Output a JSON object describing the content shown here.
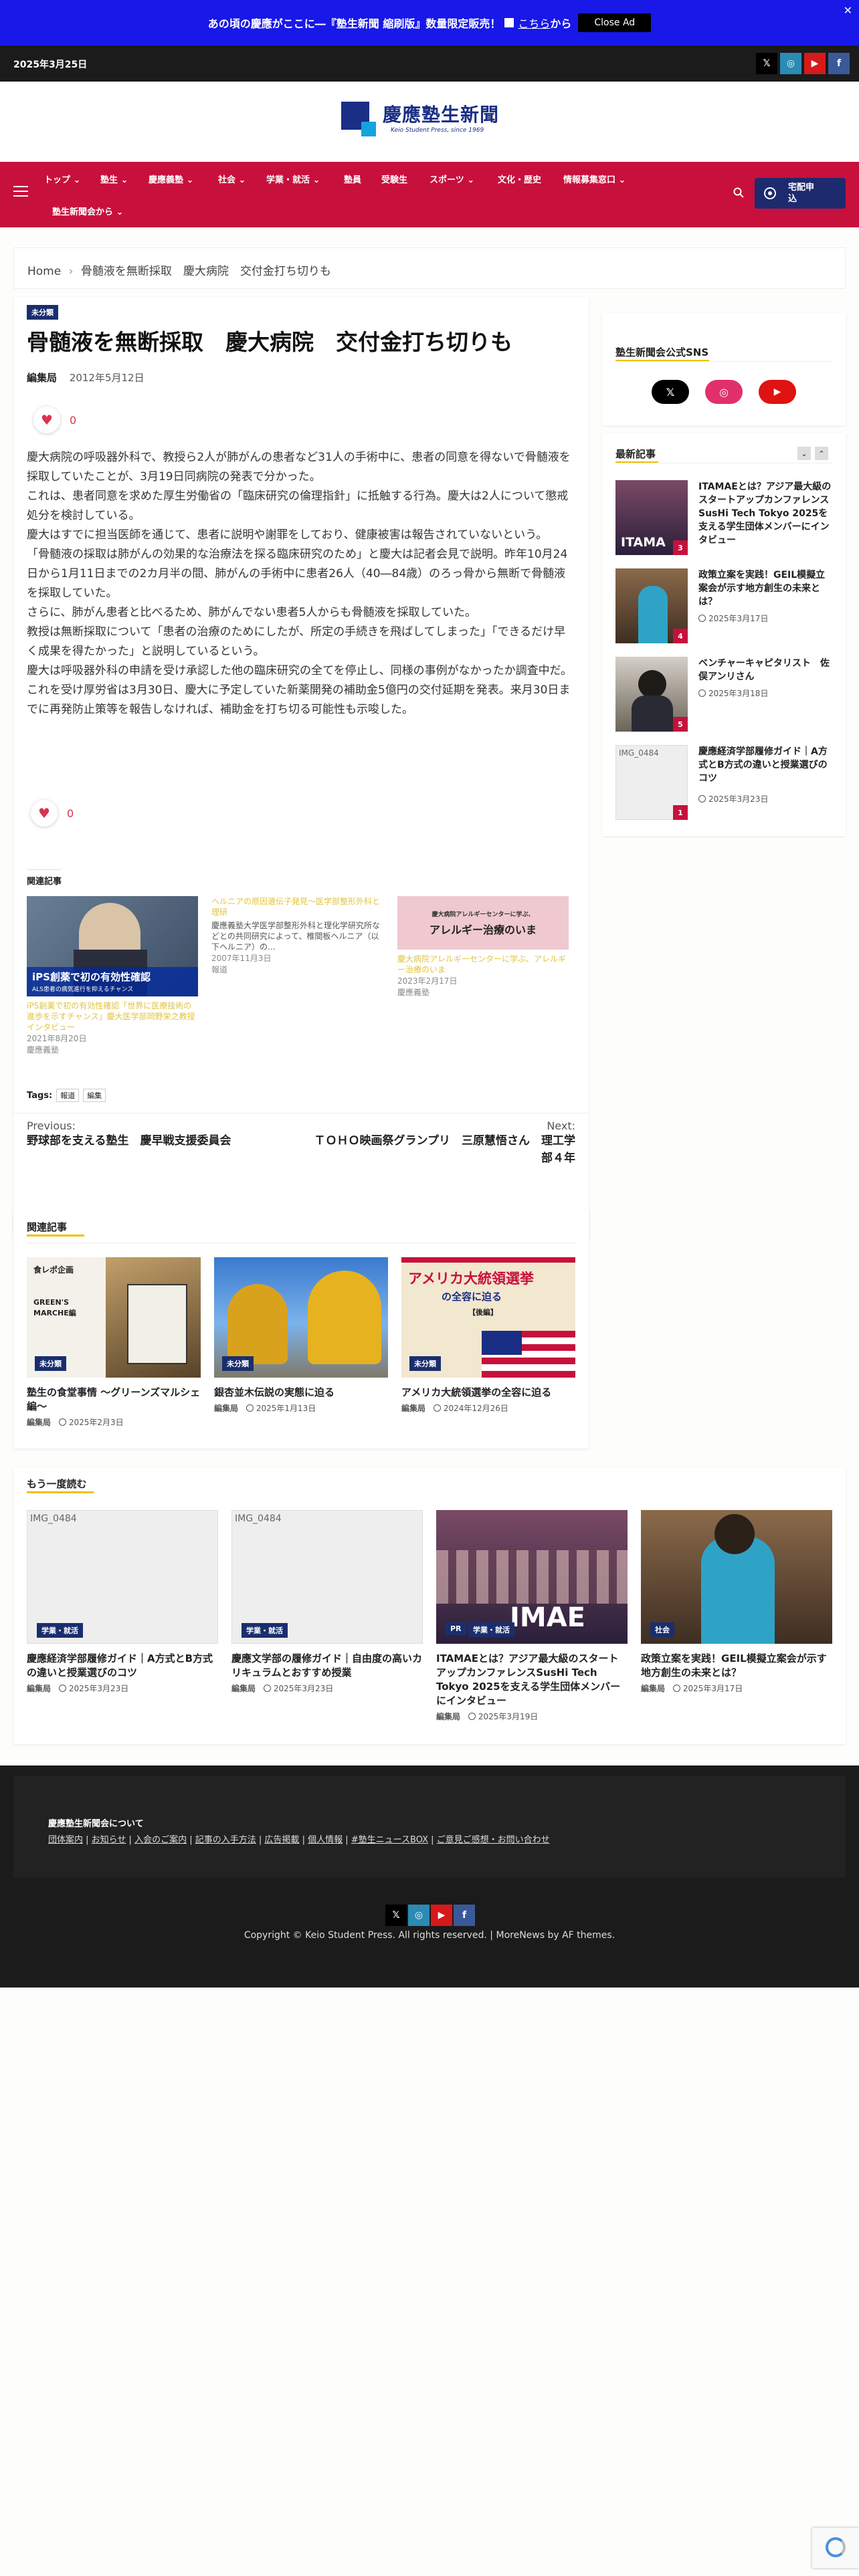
{
  "banner": {
    "text": "あの頃の慶應がここに―『塾生新聞 縮刷版』数量限定販売！",
    "link": "こちら",
    "after": "から",
    "close_ad": "Close Ad",
    "x": "✕"
  },
  "topbar": {
    "date": "2025年3月25日",
    "social": [
      "𝕏",
      "◎",
      "▶",
      "f"
    ]
  },
  "logo": {
    "title": "慶應塾生新聞",
    "subtitle": "Keio Student Press, since 1969"
  },
  "nav": {
    "items": [
      "トップ",
      "塾生",
      "慶應義塾",
      "社会",
      "学業・就活",
      "塾員",
      "受験生",
      "スポーツ",
      "文化・歴史",
      "情報募集窓口",
      "塾生新聞会から"
    ],
    "delivery": [
      "宅配申",
      "込"
    ]
  },
  "breadcrumb": {
    "home": "Home",
    "sep": "›",
    "current": "骨髄液を無断採取　慶大病院　交付金打ち切りも"
  },
  "article": {
    "badge": "未分類",
    "title": "骨髄液を無断採取　慶大病院　交付金打ち切りも",
    "author": "編集局",
    "date": "2012年5月12日",
    "likes": "0",
    "paragraphs": [
      "慶大病院の呼吸器外科で、教授ら2人が肺がんの患者など31人の手術中に、患者の同意を得ないで骨髄液を採取していたことが、3月19日同病院の発表で分かった。",
      "これは、患者同意を求めた厚生労働省の「臨床研究の倫理指針」に抵触する行為。慶大は2人について懲戒処分を検討している。",
      "慶大はすでに担当医師を通じて、患者に説明や謝罪をしており、健康被害は報告されていないという。",
      "「骨髄液の採取は肺がんの効果的な治療法を探る臨床研究のため」と慶大は記者会見で説明。昨年10月24日から1月11日までの2カ月半の間、肺がんの手術中に患者26人（40―84歳）のろっ骨から無断で骨髄液を採取していた。",
      "さらに、肺がん患者と比べるため、肺がんでない患者5人からも骨髄液を採取していた。",
      "教授は無断採取について「患者の治療のためにしたが、所定の手続きを飛ばしてしまった」「できるだけ早く成果を得たかった」と説明しているという。",
      "慶大は呼吸器外科の申請を受け承認した他の臨床研究の全てを停止し、同様の事例がなかったか調査中だ。",
      "これを受け厚労省は3月30日、慶大に予定していた新薬開発の補助金5億円の交付延期を発表。来月30日までに再発防止策等を報告しなければ、補助金を打ち切る可能性も示唆した。"
    ],
    "likes2": "0"
  },
  "related_inline": {
    "heading": "関連記事",
    "items": [
      {
        "img_text": "iPS創薬で初の有効性確認",
        "img_sub": "ALS患者の病気進行を抑えるチャンス",
        "title": "iPS創薬で初の有効性確認「世界に医療技術の進歩を示すチャンス」慶大医学部岡野栄之教授インタビュー",
        "date": "2021年8月20日",
        "cat": "慶應義塾"
      },
      {
        "title": "ヘルニアの原因遺伝子発見～医学部整形外科と理研",
        "excerpt": "慶應義塾大学医学部整形外科と理化学研究所などとの共同研究によって、椎間板ヘルニア（以下ヘルニア）の…",
        "date": "2007年11月3日",
        "cat": "報道"
      },
      {
        "img_text": "慶大病院アレルギーセンターに学ぶ、",
        "img_sub": "アレルギー治療のいま",
        "title": "慶大病院アレルギーセンターに学ぶ、アレルギー治療のいま",
        "date": "2023年2月17日",
        "cat": "慶應義塾"
      }
    ]
  },
  "tags": {
    "label": "Tags:",
    "items": [
      "報道",
      "編集"
    ]
  },
  "postnav": {
    "prev_label": "Previous:",
    "prev_title": "野球部を支える塾生　慶早戦支援委員会",
    "next_label": "Next:",
    "next_title": "ＴＯＨＯ映画祭グランプリ　三原慧悟さん　理工学部４年"
  },
  "related": {
    "heading": "関連記事",
    "items": [
      {
        "badge": "未分類",
        "img_text": "食レポ企画",
        "img_sub": "GREEN'S MARCHE編",
        "title": "塾生の食堂事情 ～グリーンズマルシェ編～",
        "author": "編集局",
        "date": "2025年2月3日"
      },
      {
        "badge": "未分類",
        "title": "銀杏並木伝説の実態に迫る",
        "author": "編集局",
        "date": "2025年1月13日"
      },
      {
        "badge": "未分類",
        "img_text": "アメリカ大統領選挙",
        "img_sub": "の全容に迫る",
        "img_sub2": "【後編】",
        "title": "アメリカ大統領選挙の全容に迫る",
        "author": "編集局",
        "date": "2024年12月26日"
      }
    ]
  },
  "again": {
    "heading": "もう一度読む",
    "items": [
      {
        "img_alt": "IMG_0484",
        "badge": "学業・就活",
        "title": "慶應経済学部履修ガイド｜A方式とB方式の違いと授業選びのコツ",
        "author": "編集局",
        "date": "2025年3月23日"
      },
      {
        "img_alt": "IMG_0484",
        "badge": "学業・就活",
        "title": "慶應文学部の履修ガイド｜自由度の高いカリキュラムとおすすめ授業",
        "author": "編集局",
        "date": "2025年3月23日"
      },
      {
        "badge": "PR",
        "badge2": "学業・就活",
        "img_text": "IMAE",
        "title": "ITAMAEとは？アジア最大級のスタートアップカンファレンスSusHi Tech Tokyo 2025を支える学生団体メンバーにインタビュー",
        "author": "編集局",
        "date": "2025年3月19日"
      },
      {
        "badge": "社会",
        "title": "政策立案を実践！GEIL模擬立案会が示す地方創生の未来とは？",
        "author": "編集局",
        "date": "2025年3月17日"
      }
    ]
  },
  "sidebar": {
    "sns_heading": "塾生新聞会公式SNS",
    "latest_heading": "最新記事",
    "latest": [
      {
        "num": "3",
        "img_text": "ITAMA",
        "title": "ITAMAEとは？アジア最大級のスタートアップカンファレンスSusHi Tech Tokyo 2025を支える学生団体メンバーにインタビュー"
      },
      {
        "num": "4",
        "title": "政策立案を実践！GEIL模擬立案会が示す地方創生の未来とは？",
        "date": "2025年3月17日"
      },
      {
        "num": "5",
        "title": "ベンチャーキャピタリスト　佐俣アンリさん",
        "date": "2025年3月18日"
      },
      {
        "num": "1",
        "img_alt": "IMG_0484",
        "title": "慶應経済学部履修ガイド｜A方式とB方式の違いと授業選びのコツ",
        "date": "2025年3月23日"
      }
    ]
  },
  "footer": {
    "heading": "慶應塾生新聞会について",
    "links": [
      "団体案内",
      "お知らせ",
      "入会のご案内",
      "記事の入手方法",
      "広告掲載",
      "個人情報",
      "#塾生ニュースBOX",
      "ご意見ご感想・お問い合わせ"
    ],
    "copyright": "Copyright © Keio Student Press. All rights reserved.",
    "theme": "MoreNews by AF themes."
  },
  "colors": {
    "banner": "#1818e8",
    "nav": "#c8103c",
    "badge": "#1a2e6e",
    "accent": "#f0c000"
  }
}
